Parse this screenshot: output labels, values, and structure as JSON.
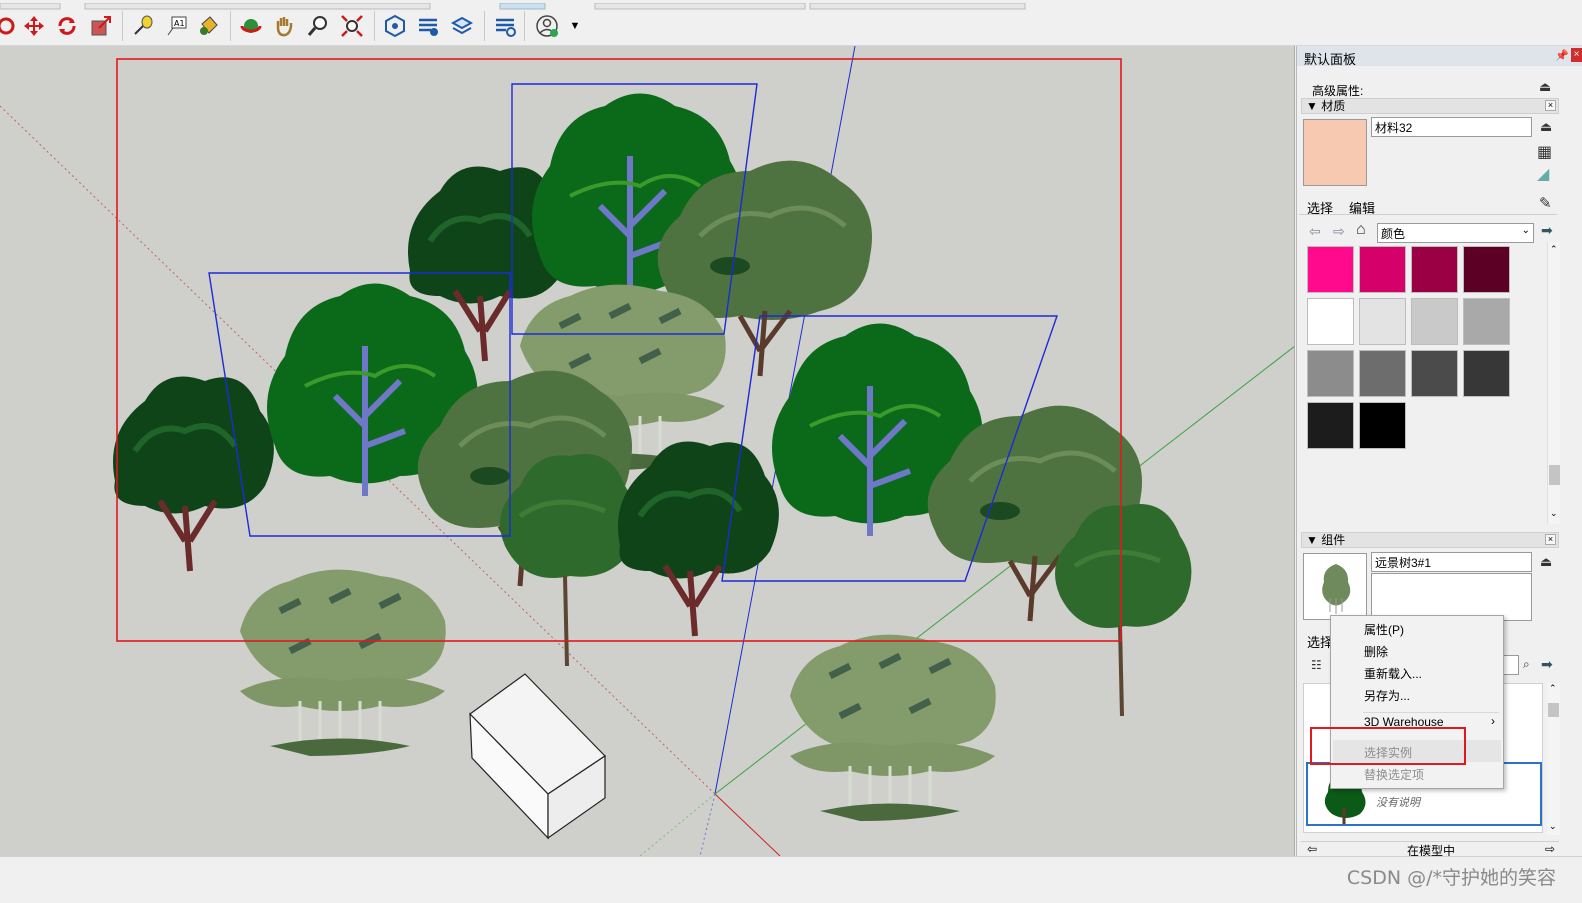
{
  "tray": {
    "title": "默认面板"
  },
  "entity_info": {
    "label": "高级属性:"
  },
  "materials": {
    "heading": "材质",
    "close_glyph": "×",
    "name_value": "材料32",
    "preview_color": "#f6c9b0",
    "tabs": [
      "选择",
      "编辑"
    ],
    "library_select": "颜色",
    "swatches": [
      "#ff0a8c",
      "#d5006a",
      "#9b0045",
      "#5c0026",
      "#ffffff",
      "#e3e3e3",
      "#c9c9c9",
      "#a9a9a9",
      "#8c8c8c",
      "#6d6d6d",
      "#4b4b4b",
      "#373737",
      "#1c1c1c",
      "#000000"
    ]
  },
  "components": {
    "heading": "组件",
    "close_glyph": "×",
    "name_value": "远景树3#1",
    "tab_select": "选择",
    "list_item_desc": "没有说明",
    "footer_label": "在模型中"
  },
  "context_menu": {
    "items": [
      "属性(P)",
      "删除",
      "重新载入...",
      "另存为...",
      "3D Warehouse",
      "选择实例",
      "替换选定项"
    ],
    "submenu_arrow": "›"
  },
  "watermark": "CSDN @/*守护她的笑容",
  "colors": {
    "selection_red": "#e3181f",
    "axis_blue": "#1c2bd6",
    "viewport_bg": "#cfcfcb"
  },
  "toolbar": {
    "icons": [
      "rotate-icon",
      "move-icon",
      "rotate-arrows-icon",
      "scale-icon",
      "tape-measure-icon",
      "text-icon",
      "paint-bucket-icon",
      "orbit-icon",
      "pan-icon",
      "zoom-icon",
      "zoom-extents-icon",
      "warehouse-icon",
      "extension-icon",
      "layers-icon",
      "settings-icon",
      "account-icon"
    ]
  }
}
